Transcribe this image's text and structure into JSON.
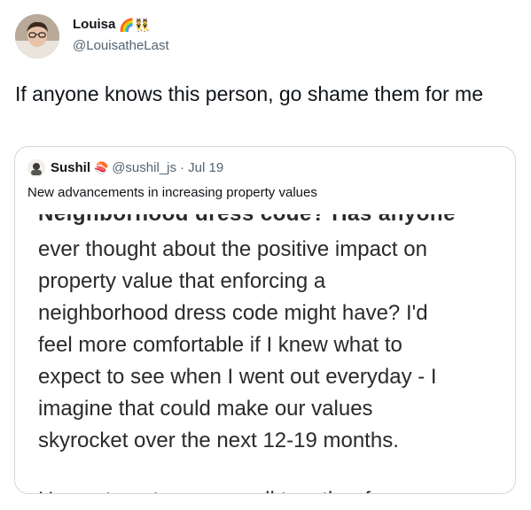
{
  "tweet": {
    "author_name": "Louisa",
    "author_emojis": "🌈👯",
    "author_handle": "@LouisatheLast",
    "text": "If anyone knows this person, go shame them for me"
  },
  "quoted": {
    "author_name": "Sushil",
    "author_emoji": "🍣",
    "author_handle": "@sushil_js",
    "date": "· Jul 19",
    "text": "New advancements in increasing property values",
    "image_text": {
      "cut_top": "Neighborhood dress code? Has anyone",
      "lines": [
        "ever thought about the positive impact on",
        "property value that enforcing a",
        "neighborhood dress code might have? I'd",
        "feel more comfortable if I knew what to",
        "expect to see when I went out everyday - I",
        "imagine that could make our values",
        "skyrocket over the next 12-19 months."
      ],
      "cut_bottom": "Happy to get a group call together for"
    }
  }
}
